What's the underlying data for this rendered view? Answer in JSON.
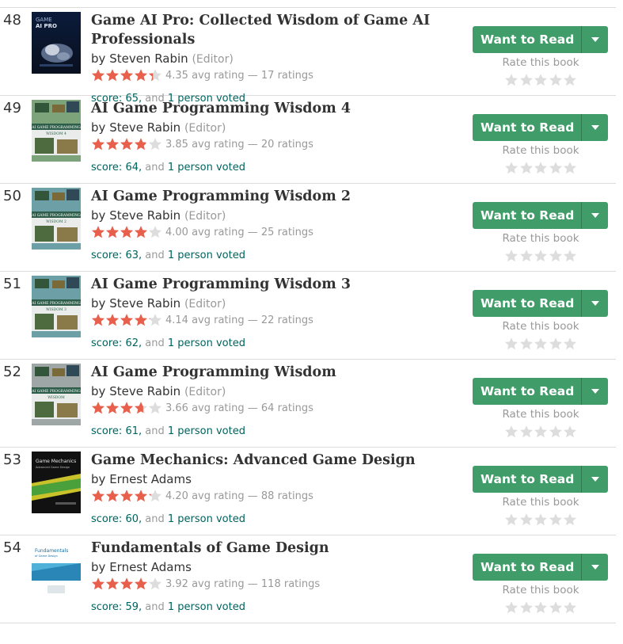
{
  "colors": {
    "star_filled": "#e8604c",
    "star_empty": "#dddddd",
    "button_green": "#409d69",
    "link_teal": "#00635d"
  },
  "books": [
    {
      "rank": "48",
      "title": "Game AI Pro: Collected Wisdom of Game AI Professionals",
      "by": "by",
      "author": "Steven Rabin",
      "role": "(Editor)",
      "rating": 4.35,
      "minirating": "4.35 avg rating — 17 ratings",
      "score": "score: 65,",
      "and": "and",
      "voted": "1 person voted",
      "cover": "game-ai-pro"
    },
    {
      "rank": "49",
      "title": "AI Game Programming Wisdom 4",
      "by": "by",
      "author": "Steve Rabin",
      "role": "(Editor)",
      "rating": 3.85,
      "minirating": "3.85 avg rating — 20 ratings",
      "score": "score: 64,",
      "and": "and",
      "voted": "1 person voted",
      "cover": "ai-wisdom-4"
    },
    {
      "rank": "50",
      "title": "AI Game Programming Wisdom 2",
      "by": "by",
      "author": "Steve Rabin",
      "role": "(Editor)",
      "rating": 4.0,
      "minirating": "4.00 avg rating — 25 ratings",
      "score": "score: 63,",
      "and": "and",
      "voted": "1 person voted",
      "cover": "ai-wisdom-2"
    },
    {
      "rank": "51",
      "title": "AI Game Programming Wisdom 3",
      "by": "by",
      "author": "Steve Rabin",
      "role": "(Editor)",
      "rating": 4.14,
      "minirating": "4.14 avg rating — 22 ratings",
      "score": "score: 62,",
      "and": "and",
      "voted": "1 person voted",
      "cover": "ai-wisdom-3"
    },
    {
      "rank": "52",
      "title": "AI Game Programming Wisdom",
      "by": "by",
      "author": "Steve Rabin",
      "role": "(Editor)",
      "rating": 3.66,
      "minirating": "3.66 avg rating — 64 ratings",
      "score": "score: 61,",
      "and": "and",
      "voted": "1 person voted",
      "cover": "ai-wisdom-1"
    },
    {
      "rank": "53",
      "title": "Game Mechanics: Advanced Game Design",
      "by": "by",
      "author": "Ernest Adams",
      "role": "",
      "rating": 4.2,
      "minirating": "4.20 avg rating — 88 ratings",
      "score": "score: 60,",
      "and": "and",
      "voted": "1 person voted",
      "cover": "game-mechanics"
    },
    {
      "rank": "54",
      "title": "Fundamentals of Game Design",
      "by": "by",
      "author": "Ernest Adams",
      "role": "",
      "rating": 3.92,
      "minirating": "3.92 avg rating — 118 ratings",
      "score": "score: 59,",
      "and": "and",
      "voted": "1 person voted",
      "cover": "fundamentals"
    }
  ],
  "actions": {
    "want_to_read": "Want to Read",
    "rate_this_book": "Rate this book"
  },
  "covers": {
    "game-ai-pro": {
      "line1": "GAME",
      "line2": "AI PRO"
    },
    "ai-wisdom-4": {
      "line1": "AI GAME PROGRAMMING",
      "line2": "WISDOM 4"
    },
    "ai-wisdom-2": {
      "line1": "AI GAME PROGRAMMING",
      "line2": "WISDOM 2"
    },
    "ai-wisdom-3": {
      "line1": "AI GAME PROGRAMMING",
      "line2": "WISDOM 3"
    },
    "ai-wisdom-1": {
      "line1": "AI GAME PROGRAMMING",
      "line2": "WISDOM"
    },
    "game-mechanics": {
      "line1": "Game Mechanics",
      "line2": "Advanced Game Design"
    },
    "fundamentals": {
      "line1": "Fundamentals",
      "line2": "of Game Design"
    }
  }
}
